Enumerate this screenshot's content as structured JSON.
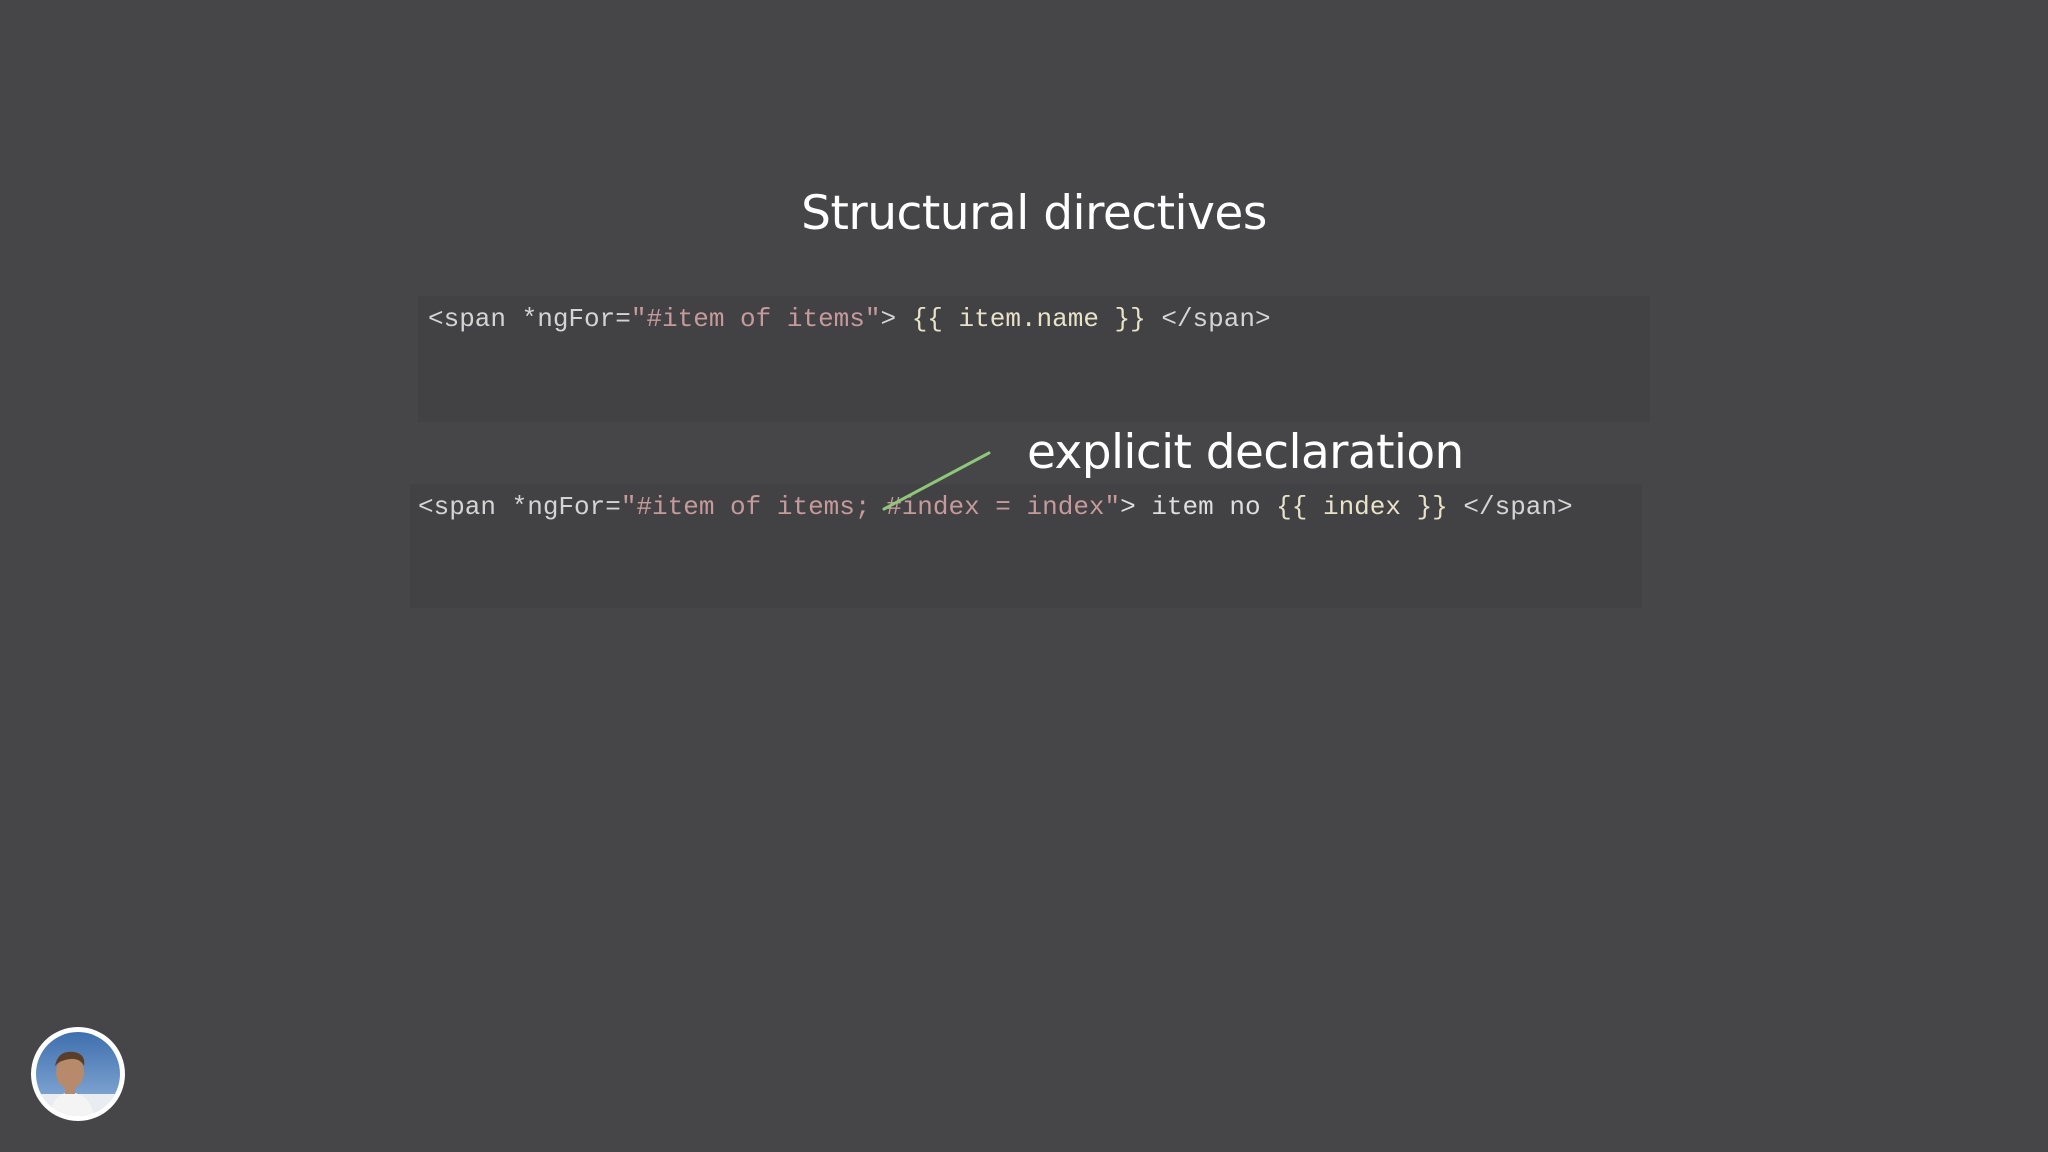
{
  "slide": {
    "title": "Structural directives",
    "annotation": "explicit declaration",
    "code_1": {
      "open_tag": "<span *ngFor=",
      "attr_value": "\"#item of items\"",
      "close_open": "> ",
      "interp": "{{ item.name }}",
      "close_tag": " </span>"
    },
    "code_2": {
      "open_tag": "<span *ngFor=",
      "attr_value": "\"#item of items; #index = index\"",
      "close_open": "> item no ",
      "interp": "{{ index }}",
      "close_tag": " </span>"
    }
  },
  "colors": {
    "background": "#464547",
    "code_background": "#424143",
    "string": "#c59a9c",
    "arrow": "#8fc77a",
    "title": "#ffffff"
  },
  "icons": {
    "avatar": "presenter-avatar"
  }
}
